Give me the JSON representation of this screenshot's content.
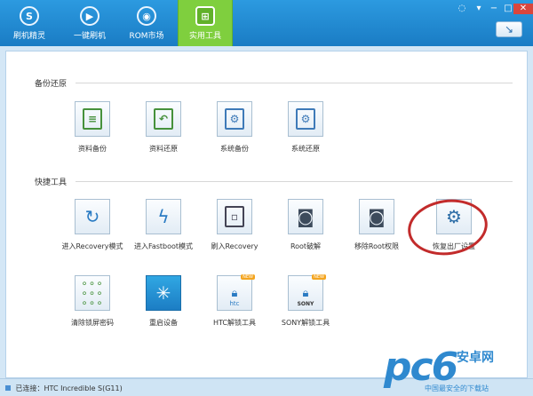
{
  "nav": {
    "tabs": [
      {
        "label": "刷机精灵",
        "icon": "s-logo-icon"
      },
      {
        "label": "一键刷机",
        "icon": "play-icon"
      },
      {
        "label": "ROM市场",
        "icon": "android-icon"
      },
      {
        "label": "实用工具",
        "icon": "grid-icon",
        "active": true
      }
    ]
  },
  "sections": {
    "backup": {
      "title": "备份还原",
      "items": [
        {
          "label": "资料备份",
          "icon": "document-icon"
        },
        {
          "label": "资料还原",
          "icon": "document-restore-icon"
        },
        {
          "label": "系统备份",
          "icon": "system-backup-icon"
        },
        {
          "label": "系统还原",
          "icon": "system-restore-icon"
        }
      ]
    },
    "tools": {
      "title": "快捷工具",
      "items": [
        {
          "label": "进入Recovery模式",
          "icon": "refresh-icon"
        },
        {
          "label": "进入Fastboot模式",
          "icon": "lightning-icon"
        },
        {
          "label": "刷入Recovery",
          "icon": "tablet-icon"
        },
        {
          "label": "Root破解",
          "icon": "android-icon"
        },
        {
          "label": "移除Root权限",
          "icon": "android-remove-icon"
        },
        {
          "label": "恢复出厂设置",
          "icon": "gears-icon"
        },
        {
          "label": "清除锁屏密码",
          "icon": "pattern-lock-icon"
        },
        {
          "label": "重启设备",
          "icon": "loading-icon"
        },
        {
          "label": "HTC解锁工具",
          "icon": "lock-htc-icon",
          "badge": "NEW",
          "brand": "htc"
        },
        {
          "label": "SONY解锁工具",
          "icon": "lock-sony-icon",
          "badge": "NEW",
          "brand": "SONY"
        }
      ]
    }
  },
  "status": {
    "text": "已连接：HTC Incredible S(G11)"
  },
  "watermark": {
    "logo": "pc6",
    "name": "安卓网",
    "tagline": "中国最安全的下载站"
  },
  "colors": {
    "accent": "#1a7cc4",
    "active_tab": "#7fcf3e",
    "highlight_circle": "#c22b2b"
  }
}
